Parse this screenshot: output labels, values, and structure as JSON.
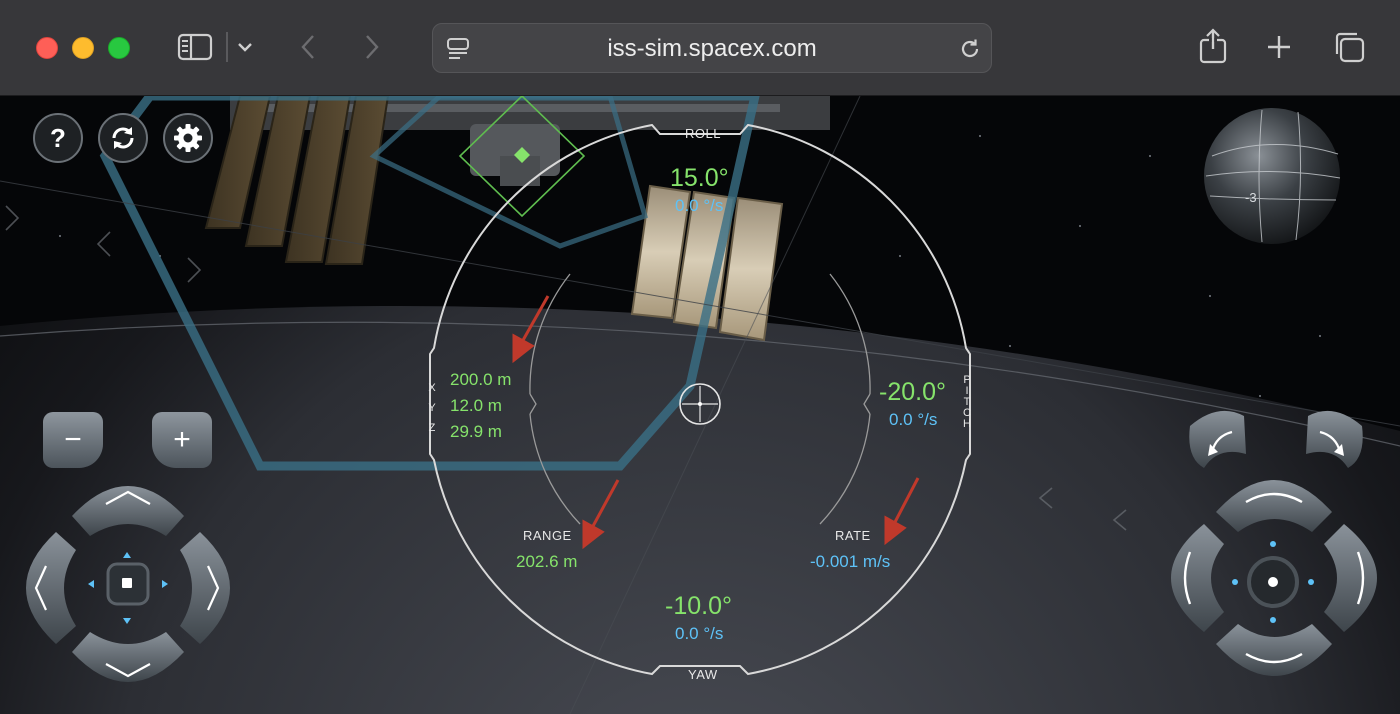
{
  "browser": {
    "url": "iss-sim.spacex.com",
    "traffic_lights": [
      "close",
      "minimize",
      "zoom"
    ],
    "icons": {
      "sidebar": "sidebar-icon",
      "sidebar_menu": "chevron-down-icon",
      "back": "chevron-left-icon",
      "forward": "chevron-right-icon",
      "page_menu": "page-menu-icon",
      "reload": "reload-icon",
      "share": "share-icon",
      "new_tab": "plus-icon",
      "tabs": "tabs-overview-icon"
    }
  },
  "top_buttons": {
    "help_label": "?",
    "help_icon": "question-icon",
    "reset_icon": "reset-cycle-icon",
    "settings_icon": "gear-icon"
  },
  "hud": {
    "roll_label": "ROLL",
    "roll_value": "15.0°",
    "roll_rate": "0.0 °/s",
    "pitch_letters": [
      "P",
      "I",
      "T",
      "C",
      "H"
    ],
    "pitch_value": "-20.0°",
    "pitch_rate": "0.0 °/s",
    "yaw_label": "YAW",
    "yaw_value": "-10.0°",
    "yaw_rate": "0.0 °/s",
    "xyz_letters": [
      "X",
      "Y",
      "Z"
    ],
    "x_value": "200.0 m",
    "y_value": "12.0 m",
    "z_value": "29.9 m",
    "range_label": "RANGE",
    "range_value": "202.6 m",
    "rate_label": "RATE",
    "rate_value": "-0.001 m/s"
  },
  "orientation_ball": {
    "label": "-3"
  },
  "left_controls": {
    "zoom_out_label": "−",
    "zoom_in_label": "+",
    "icons": [
      "translate-up-icon",
      "translate-down-icon",
      "translate-left-icon",
      "translate-right-icon",
      "translate-center-icon"
    ]
  },
  "right_controls": {
    "icons": [
      "roll-left-icon",
      "roll-right-icon",
      "pitch-up-icon",
      "pitch-down-icon",
      "yaw-left-icon",
      "yaw-right-icon",
      "rotation-center-icon"
    ]
  },
  "colors": {
    "green": "#86e36b",
    "blue": "#5ec2f7",
    "arrow_red": "#c0392b",
    "hud_line": "#d9d9d9",
    "path_blue": "#3a6f86"
  }
}
